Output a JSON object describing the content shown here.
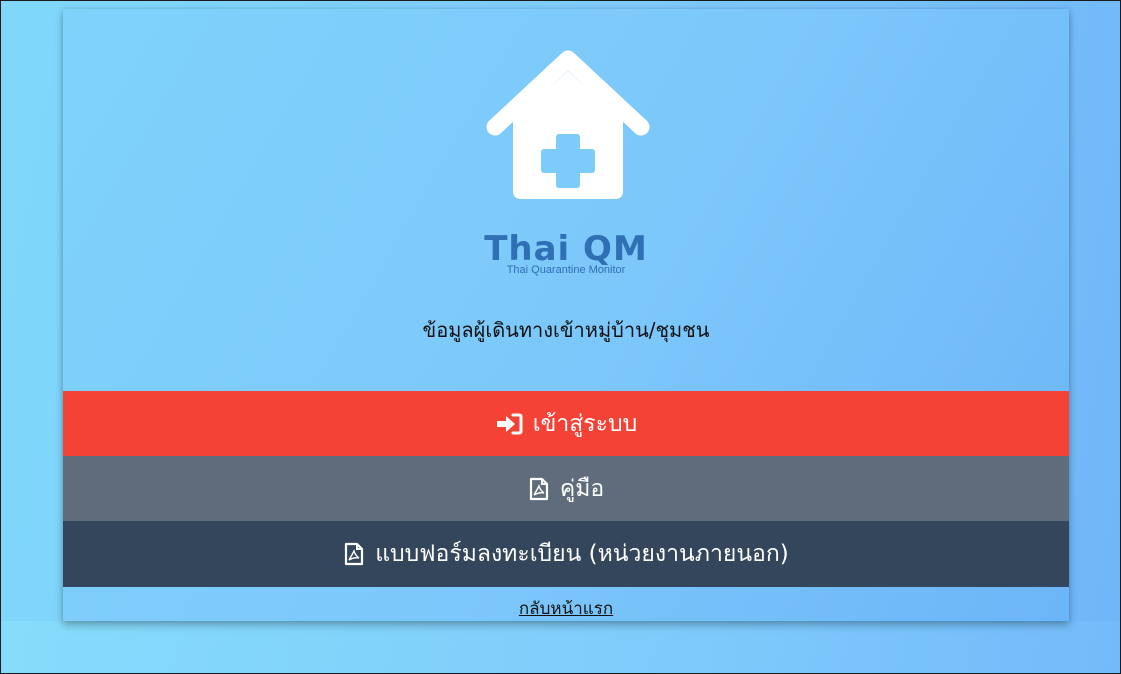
{
  "app": {
    "brand_title": "Thai QM",
    "brand_subtitle": "Thai Quarantine Monitor",
    "subtitle": "ข้อมูลผู้เดินทางเข้าหมู่บ้าน/ชุมชน"
  },
  "buttons": {
    "login": {
      "label": "เข้าสู่ระบบ",
      "icon": "sign-in-icon",
      "color": "#f44336"
    },
    "manual": {
      "label": "คู่มือ",
      "icon": "pdf-file-icon",
      "color": "#5e6c7b"
    },
    "register_form": {
      "label": "แบบฟอร์มลงทะเบียน (หน่วยงานภายนอก)",
      "icon": "pdf-file-icon",
      "color": "#34465c"
    }
  },
  "links": {
    "back_home": "กลับหน้าแรก"
  },
  "colors": {
    "background": "#7ecbfb",
    "brand": "#2f6fb4"
  }
}
